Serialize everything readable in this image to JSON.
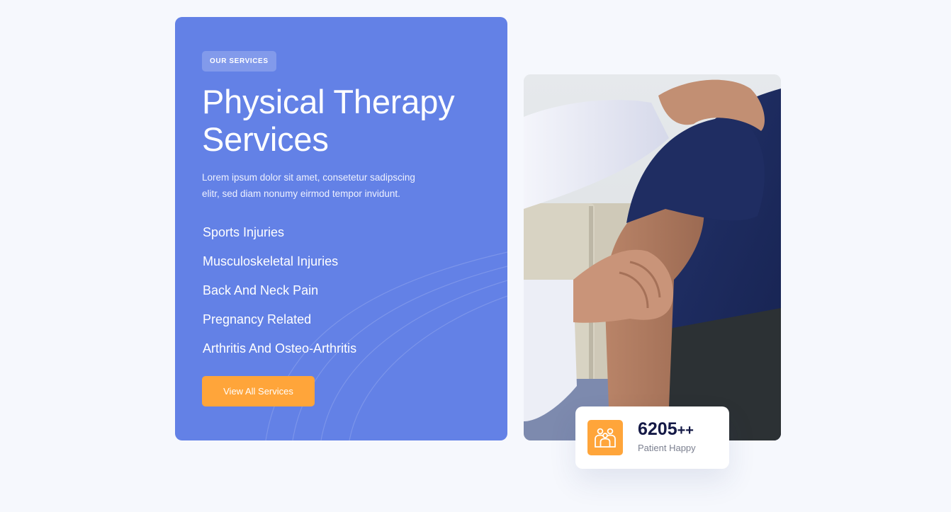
{
  "services": {
    "badge": "OUR SERVICES",
    "title_line1": "Physical Therapy",
    "title_line2": "Services",
    "description_line1": "Lorem ipsum dolor sit amet, consetetur sadipscing",
    "description_line2": "elitr, sed diam nonumy eirmod tempor invidunt.",
    "items": [
      {
        "label": "Sports Injuries"
      },
      {
        "label": "Musculoskeletal Injuries"
      },
      {
        "label": "Back And Neck Pain"
      },
      {
        "label": "Pregnancy Related"
      },
      {
        "label": "Arthritis And Osteo-Arthritis"
      }
    ],
    "cta_label": "View All Services"
  },
  "stat": {
    "number": "6205",
    "suffix": "++",
    "label": "Patient Happy",
    "icon": "people-group-icon"
  },
  "photo": {
    "subject": "therapist-treating-patient-shoulder-photo"
  },
  "colors": {
    "page_background": "#f6f8fd",
    "card_primary": "#6381e6",
    "accent_orange": "#ffa53a",
    "stat_number": "#141946",
    "stat_label": "#7c8090"
  }
}
